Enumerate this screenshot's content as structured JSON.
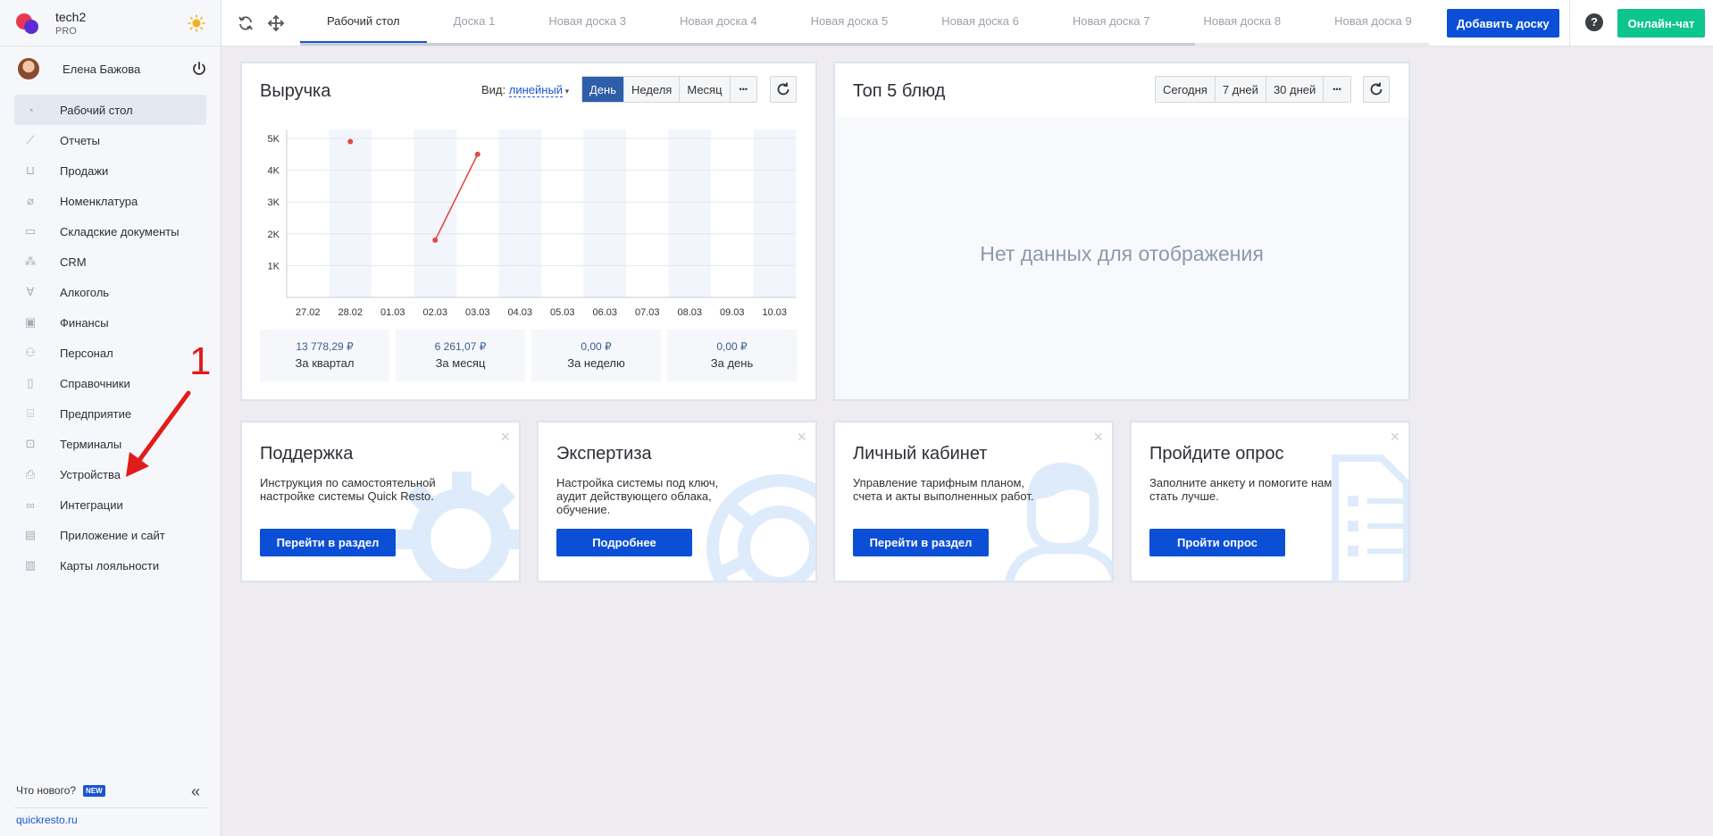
{
  "brand": {
    "name": "tech2",
    "plan": "PRO"
  },
  "user": {
    "name": "Елена Бажова"
  },
  "sidebar": {
    "items": [
      {
        "label": "Рабочий стол",
        "icon": "dashboard-icon"
      },
      {
        "label": "Отчеты",
        "icon": "chart-icon"
      },
      {
        "label": "Продажи",
        "icon": "basket-icon"
      },
      {
        "label": "Номенклатура",
        "icon": "tag-icon"
      },
      {
        "label": "Складские документы",
        "icon": "box-icon"
      },
      {
        "label": "CRM",
        "icon": "people-icon"
      },
      {
        "label": "Алкоголь",
        "icon": "glass-icon"
      },
      {
        "label": "Финансы",
        "icon": "wallet-icon"
      },
      {
        "label": "Персонал",
        "icon": "staff-icon"
      },
      {
        "label": "Справочники",
        "icon": "book-icon"
      },
      {
        "label": "Предприятие",
        "icon": "building-icon"
      },
      {
        "label": "Терминалы",
        "icon": "terminal-icon"
      },
      {
        "label": "Устройства",
        "icon": "printer-icon"
      },
      {
        "label": "Интеграции",
        "icon": "link-icon"
      },
      {
        "label": "Приложение и сайт",
        "icon": "app-icon"
      },
      {
        "label": "Карты лояльности",
        "icon": "card-icon"
      }
    ],
    "whats_new": "Что нового?",
    "new_badge": "NEW",
    "site": "quickresto.ru"
  },
  "topbar": {
    "tabs": [
      "Рабочий стол",
      "Доска 1",
      "Новая доска 3",
      "Новая доска 4",
      "Новая доска 5",
      "Новая доска 6",
      "Новая доска 7",
      "Новая доска 8",
      "Новая доска 9"
    ],
    "add_board": "Добавить доску",
    "help": "?",
    "chat": "Онлайн-чат"
  },
  "revenue": {
    "title": "Выручка",
    "view_label": "Вид:",
    "view_value": "линейный",
    "periods": [
      "День",
      "Неделя",
      "Месяц"
    ],
    "more": "•••",
    "stats": [
      {
        "value": "13 778,29 ₽",
        "label": "За квартал"
      },
      {
        "value": "6 261,07 ₽",
        "label": "За месяц"
      },
      {
        "value": "0,00 ₽",
        "label": "За неделю"
      },
      {
        "value": "0,00 ₽",
        "label": "За день"
      }
    ]
  },
  "chart_data": {
    "type": "line",
    "categories": [
      "27.02",
      "28.02",
      "01.03",
      "02.03",
      "03.03",
      "04.03",
      "05.03",
      "06.03",
      "07.03",
      "08.03",
      "09.03",
      "10.03"
    ],
    "values": [
      null,
      4900,
      null,
      1800,
      4500,
      null,
      null,
      null,
      null,
      null,
      null,
      null
    ],
    "y_ticks": [
      "1K",
      "2K",
      "3K",
      "4K",
      "5K"
    ],
    "ylim": [
      0,
      5000
    ],
    "color": "#e34848"
  },
  "top5": {
    "title": "Топ 5 блюд",
    "periods": [
      "Сегодня",
      "7 дней",
      "30 дней"
    ],
    "more": "•••",
    "empty": "Нет данных для отображения"
  },
  "promos": [
    {
      "title": "Поддержка",
      "text": "Инструкция по самостоятельной настройке системы Quick Resto.",
      "button": "Перейти в раздел"
    },
    {
      "title": "Экспертиза",
      "text": "Настройка системы под ключ, аудит действующего облака, обучение.",
      "button": "Подробнее"
    },
    {
      "title": "Личный кабинет",
      "text": "Управление тарифным планом, счета и акты выполненных работ.",
      "button": "Перейти в раздел"
    },
    {
      "title": "Пройдите опрос",
      "text": "Заполните анкету и помогите нам стать лучше.",
      "button": "Пройти опрос"
    }
  ],
  "annotation": {
    "number": "1"
  },
  "colors": {
    "accent": "#0b4fd6",
    "chat": "#0fc58f",
    "annotation": "#e21b1b"
  }
}
